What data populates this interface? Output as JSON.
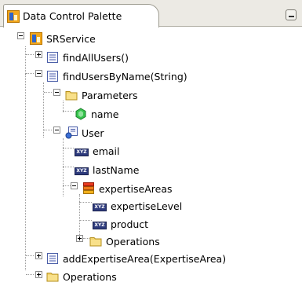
{
  "palette": {
    "tab_label": "Data Control Palette",
    "tab_icon": "data-control-icon",
    "minimize_icon": "minimize-icon"
  },
  "tree": {
    "root": {
      "label": "SRService",
      "icon": "data-control-icon"
    },
    "find_all_users": {
      "label": "findAllUsers()",
      "icon": "method-icon"
    },
    "find_users_by_name": {
      "label": "findUsersByName(String)",
      "icon": "method-icon"
    },
    "parameters": {
      "label": "Parameters",
      "icon": "folder-icon"
    },
    "param_name": {
      "label": "name",
      "icon": "parameter-icon"
    },
    "user": {
      "label": "User",
      "icon": "bean-icon"
    },
    "email": {
      "label": "email",
      "icon": "attribute-icon"
    },
    "last_name": {
      "label": "lastName",
      "icon": "attribute-icon"
    },
    "expertise_areas": {
      "label": "expertiseAreas",
      "icon": "collection-icon"
    },
    "expertise_level": {
      "label": "expertiseLevel",
      "icon": "attribute-icon"
    },
    "product": {
      "label": "product",
      "icon": "attribute-icon"
    },
    "operations_inner": {
      "label": "Operations",
      "icon": "folder-icon"
    },
    "add_expertise_area": {
      "label": "addExpertiseArea(ExpertiseArea)",
      "icon": "method-icon"
    },
    "operations_outer": {
      "label": "Operations",
      "icon": "folder-icon"
    }
  },
  "attribute_badge_text": "XYZ"
}
